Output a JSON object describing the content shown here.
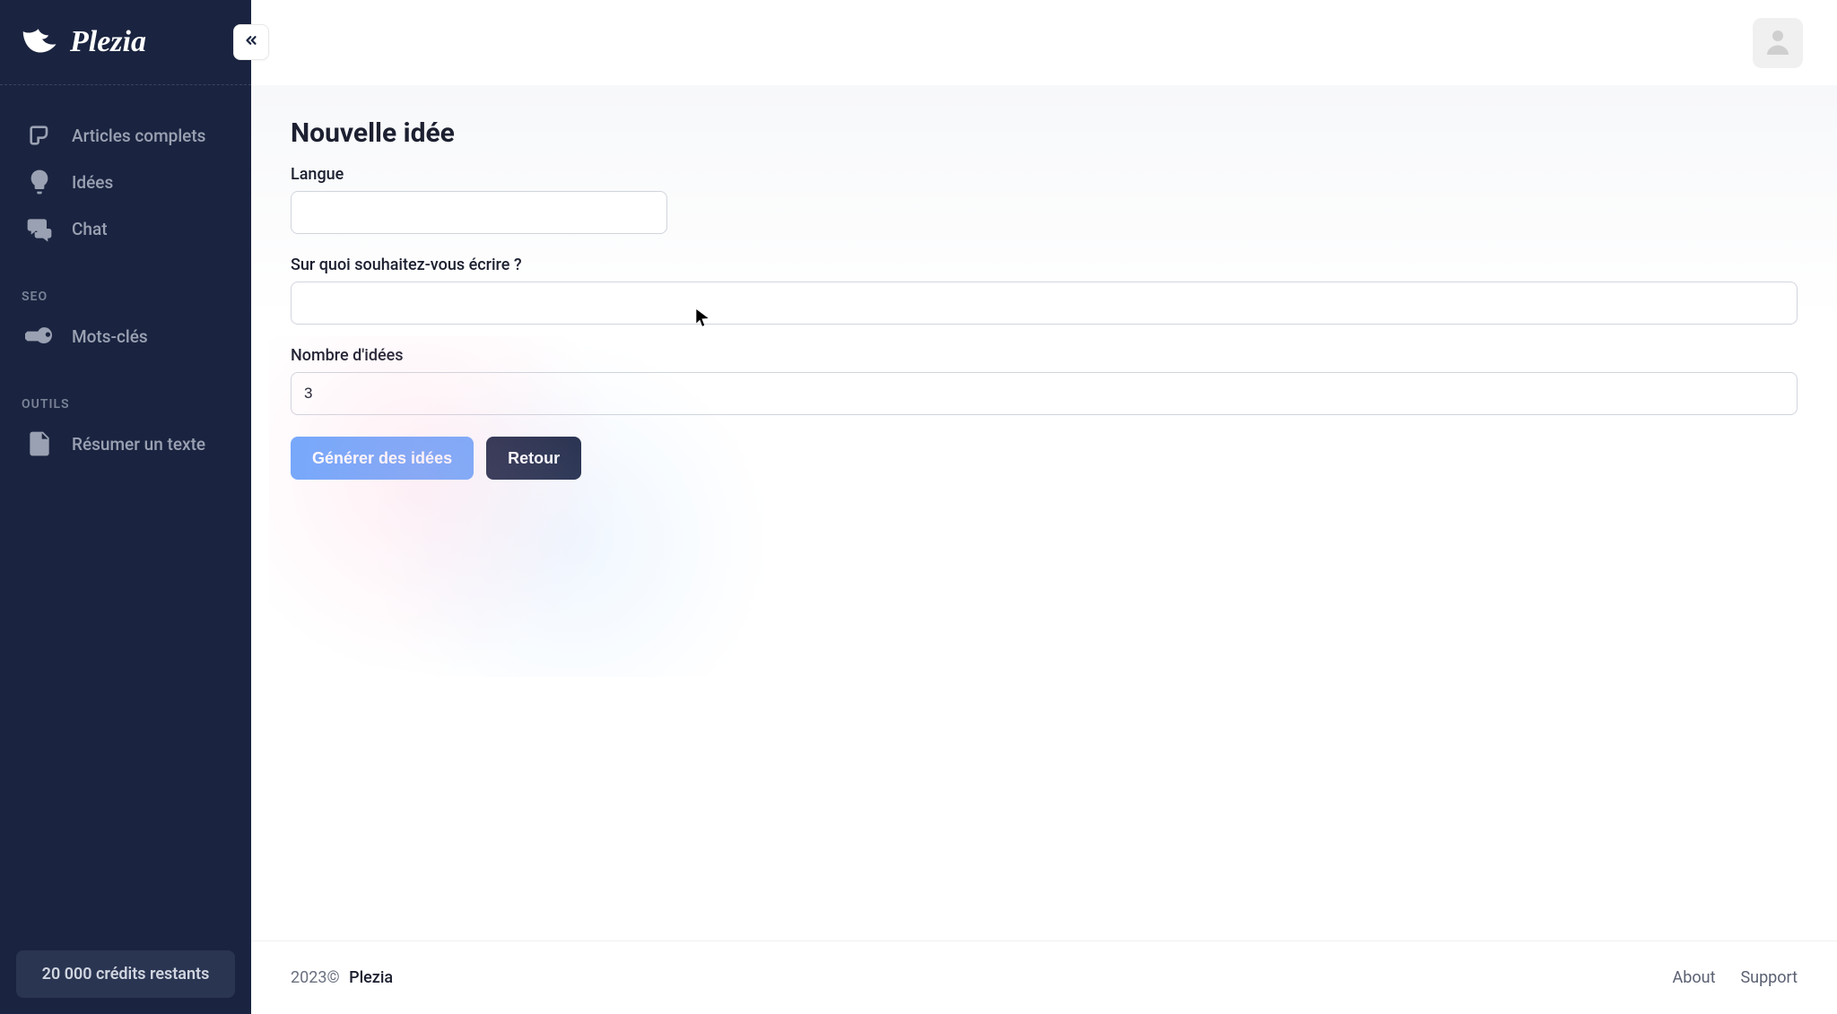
{
  "brand": "Plezia",
  "sidebar": {
    "items": {
      "articles": "Articles complets",
      "ideas": "Idées",
      "chat": "Chat",
      "keywords": "Mots-clés",
      "summarize": "Résumer un texte"
    },
    "sections": {
      "seo": "SEO",
      "tools": "OUTILS"
    },
    "credits_label": "20 000 crédits restants"
  },
  "page": {
    "title": "Nouvelle idée",
    "fields": {
      "language_label": "Langue",
      "topic_label": "Sur quoi souhaitez-vous écrire ?",
      "count_label": "Nombre d'idées",
      "count_value": "3"
    },
    "buttons": {
      "generate": "Générer des idées",
      "back": "Retour"
    }
  },
  "footer": {
    "year": "2023©",
    "brand": "Plezia",
    "about": "About",
    "support": "Support"
  }
}
